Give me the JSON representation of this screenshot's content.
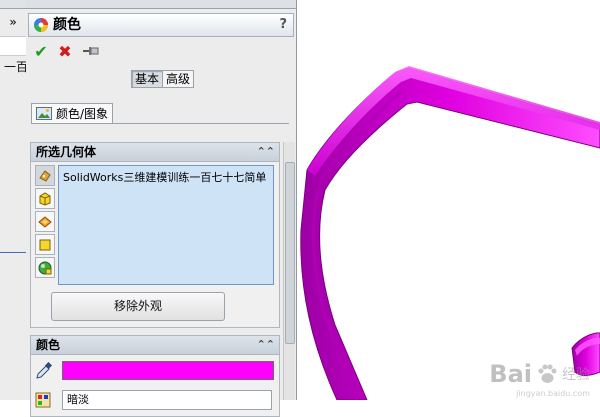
{
  "left_tree": {
    "expand_label": "»",
    "partial_text": "一百七"
  },
  "panel": {
    "title": "颜色",
    "help_label": "?",
    "ok_label": "✔",
    "cancel_label": "✖",
    "modes": [
      {
        "label": "基本",
        "active": true
      },
      {
        "label": "高级",
        "active": false
      }
    ],
    "section_tab": "颜色/图象",
    "geometry_group": {
      "title": "所选几何体",
      "collapse_label": "⌃",
      "selected_items": [
        "SolidWorks三维建模训练一百七十七简单"
      ],
      "remove_button_label": "移除外观"
    },
    "color_group": {
      "title": "颜色",
      "collapse_label": "⌃",
      "swatch_color": "#ff00ff",
      "second_row_text": "暗淡"
    }
  },
  "colors": {
    "model_magenta": "#e000e0",
    "selection_bg": "#cfe3f7",
    "group_header": "#c8d1db"
  },
  "watermark": {
    "logo_text": "Bai",
    "text": "经验",
    "sub": "jingyan.baidu.com"
  }
}
